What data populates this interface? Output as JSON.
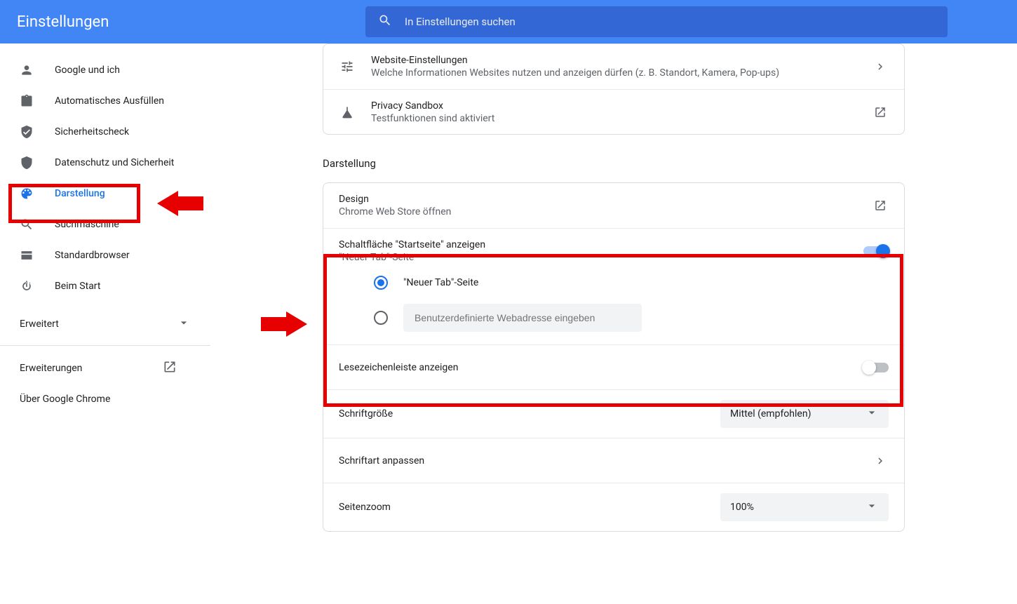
{
  "header": {
    "title": "Einstellungen",
    "search_placeholder": "In Einstellungen suchen"
  },
  "sidebar": {
    "items": [
      {
        "label": "Google und ich"
      },
      {
        "label": "Automatisches Ausfüllen"
      },
      {
        "label": "Sicherheitscheck"
      },
      {
        "label": "Datenschutz und Sicherheit"
      },
      {
        "label": "Darstellung"
      },
      {
        "label": "Suchmaschine"
      },
      {
        "label": "Standardbrowser"
      },
      {
        "label": "Beim Start"
      }
    ],
    "advanced_label": "Erweitert",
    "extensions_label": "Erweiterungen",
    "about_label": "Über Google Chrome"
  },
  "privacy_card": {
    "site_settings": {
      "title": "Website-Einstellungen",
      "sub": "Welche Informationen Websites nutzen und anzeigen dürfen (z. B. Standort, Kamera, Pop-ups)"
    },
    "sandbox": {
      "title": "Privacy Sandbox",
      "sub": "Testfunktionen sind aktiviert"
    }
  },
  "appearance": {
    "heading": "Darstellung",
    "design": {
      "title": "Design",
      "sub": "Chrome Web Store öffnen"
    },
    "home_button": {
      "title": "Schaltfläche \"Startseite\" anzeigen",
      "sub": "\"Neuer Tab\"-Seite",
      "radio_newtab": "\"Neuer Tab\"-Seite",
      "url_placeholder": "Benutzerdefinierte Webadresse eingeben"
    },
    "bookmarks_bar": "Lesezeichenleiste anzeigen",
    "font_size_label": "Schriftgröße",
    "font_size_value": "Mittel (empfohlen)",
    "customize_fonts": "Schriftart anpassen",
    "page_zoom_label": "Seitenzoom",
    "page_zoom_value": "100%"
  }
}
